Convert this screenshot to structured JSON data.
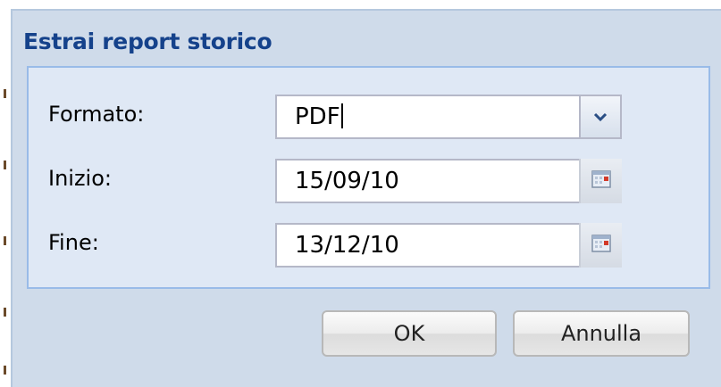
{
  "dialog": {
    "title": "Estrai report storico"
  },
  "form": {
    "format": {
      "label": "Formato:",
      "value": "PDF"
    },
    "start": {
      "label": "Inizio:",
      "value": "15/09/10"
    },
    "end": {
      "label": "Fine:",
      "value": "13/12/10"
    }
  },
  "buttons": {
    "ok_label": "OK",
    "cancel_label": "Annulla"
  },
  "colors": {
    "title": "#15428b",
    "dialog_bg": "#cfdbea",
    "fieldset_bg": "#dfe8f5",
    "fieldset_border": "#99bbe8"
  },
  "icons": {
    "format_trigger": "chevron-down-icon",
    "date_trigger": "calendar-icon"
  }
}
